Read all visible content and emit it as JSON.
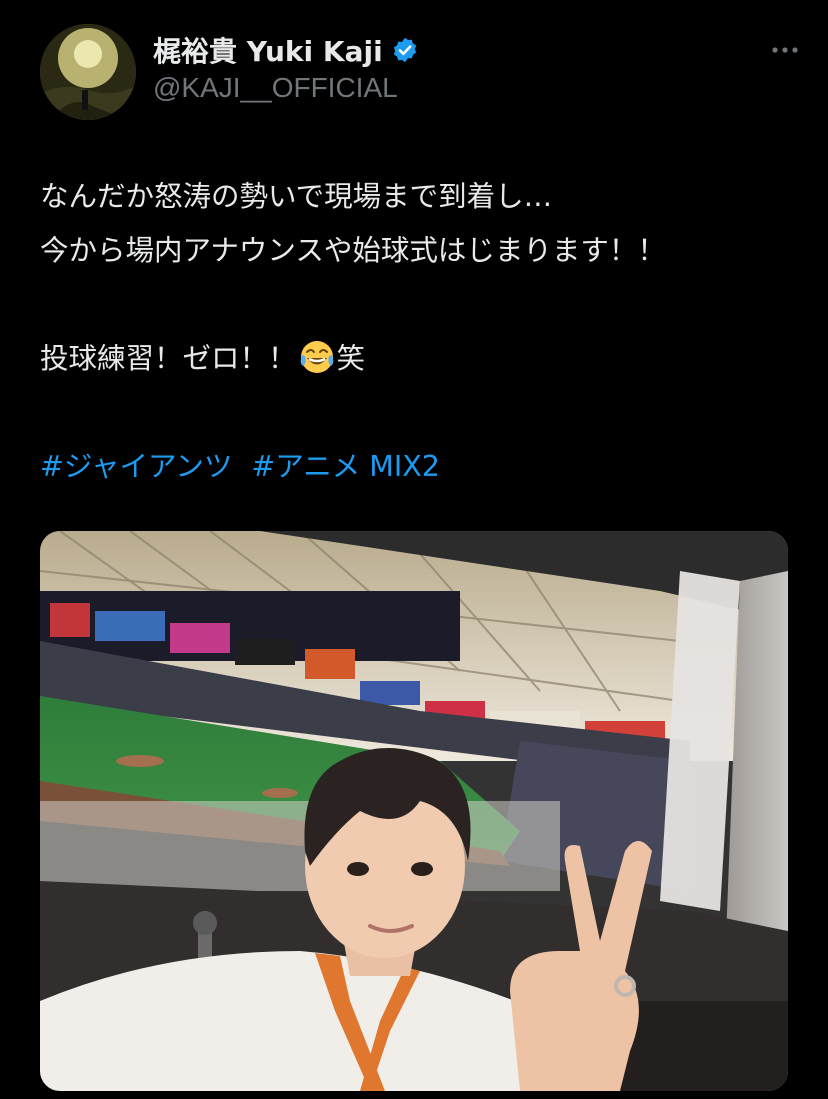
{
  "tweet": {
    "author": {
      "display_name": "梶裕貴 Yuki Kaji",
      "handle": "@KAJI__OFFICIAL",
      "verified": true
    },
    "text_lines": [
      "なんだか怒涛の勢いで現場まで到着し…",
      "今から場内アナウンスや始球式はじまります！！"
    ],
    "line3_prefix": "投球練習！ゼロ！！",
    "line3_emoji": "face-with-tears-of-joy",
    "line3_suffix": "笑",
    "hashtags": [
      "#ジャイアンツ",
      "#アニメ MIX2"
    ],
    "media": {
      "type": "photo",
      "description": "selfie-in-stadium-broadcast-booth"
    }
  },
  "colors": {
    "background": "#000000",
    "text": "#e7e9ea",
    "secondary": "#71767b",
    "link": "#1d9bf0",
    "verified": "#1d9bf0"
  },
  "icons": {
    "verified": "verified-badge-icon",
    "more": "more-horizontal-icon"
  }
}
